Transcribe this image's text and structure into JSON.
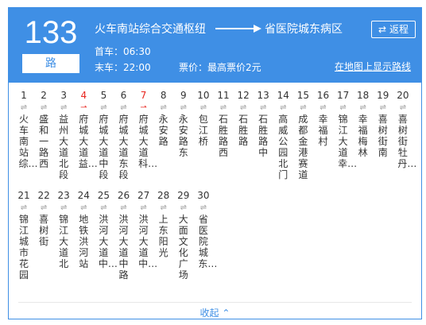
{
  "route": {
    "number": "133",
    "suffix": "路"
  },
  "header": {
    "origin": "火车南站综合交通枢纽",
    "destination": "省医院城东病区",
    "return_label": "返程",
    "first_bus": "首车：06:30",
    "last_bus": "末车：22:00",
    "price": "票价：最高票价2元",
    "map_link": "在地图上显示路线"
  },
  "colors": {
    "accent": "#3f8fe5",
    "highlight": "#e8261f",
    "text": "#333333"
  },
  "stops": [
    {
      "num": "1",
      "name": "火车南站综…",
      "hl": false
    },
    {
      "num": "2",
      "name": "盛和一路西",
      "hl": false
    },
    {
      "num": "3",
      "name": "益州大道北段",
      "hl": false
    },
    {
      "num": "4",
      "name": "府城大道益…",
      "hl": true
    },
    {
      "num": "5",
      "name": "府城大道中段",
      "hl": false
    },
    {
      "num": "6",
      "name": "府城大道东段",
      "hl": false
    },
    {
      "num": "7",
      "name": "府城大道科…",
      "hl": true
    },
    {
      "num": "8",
      "name": "永安路",
      "hl": false
    },
    {
      "num": "9",
      "name": "永安路东",
      "hl": false
    },
    {
      "num": "10",
      "name": "包江桥",
      "hl": false
    },
    {
      "num": "11",
      "name": "石胜路西",
      "hl": false
    },
    {
      "num": "12",
      "name": "石胜路",
      "hl": false
    },
    {
      "num": "13",
      "name": "石胜路中",
      "hl": false
    },
    {
      "num": "14",
      "name": "高威公园北门",
      "hl": false
    },
    {
      "num": "15",
      "name": "成都金港赛道",
      "hl": false
    },
    {
      "num": "16",
      "name": "幸福村",
      "hl": false
    },
    {
      "num": "17",
      "name": "锦江大道幸…",
      "hl": false
    },
    {
      "num": "18",
      "name": "幸福梅林",
      "hl": false
    },
    {
      "num": "19",
      "name": "喜树街南",
      "hl": false
    },
    {
      "num": "20",
      "name": "喜树街牡丹…",
      "hl": false
    },
    {
      "num": "21",
      "name": "锦江城市花园",
      "hl": false
    },
    {
      "num": "22",
      "name": "喜树街",
      "hl": false
    },
    {
      "num": "23",
      "name": "锦江大道北",
      "hl": false
    },
    {
      "num": "24",
      "name": "地铁洪河站",
      "hl": false
    },
    {
      "num": "25",
      "name": "洪河大道中…",
      "hl": false
    },
    {
      "num": "26",
      "name": "洪河大道中路",
      "hl": false
    },
    {
      "num": "27",
      "name": "洪河大道中…",
      "hl": false
    },
    {
      "num": "28",
      "name": "上东阳光",
      "hl": false
    },
    {
      "num": "29",
      "name": "大面文化广场",
      "hl": false
    },
    {
      "num": "30",
      "name": "省医院城东…",
      "hl": false
    }
  ],
  "collapse_label": "收起"
}
